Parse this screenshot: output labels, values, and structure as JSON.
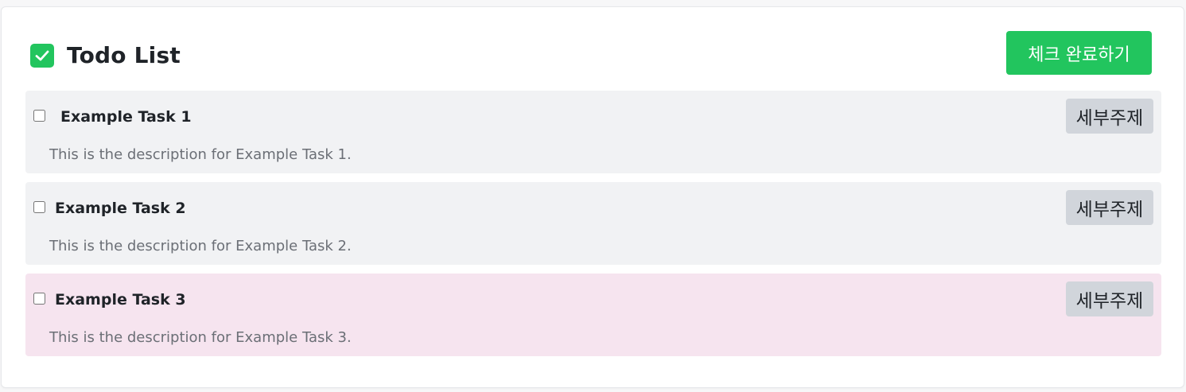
{
  "header": {
    "title": "Todo List",
    "done_button_label": "체크 완료하기",
    "icon": "checkbox-checked-icon"
  },
  "colors": {
    "accent": "#22c55e",
    "row_default": "#f1f2f4",
    "row_highlight": "#f6e4ef",
    "sub_button": "#d1d5db"
  },
  "tasks": [
    {
      "title": "Example Task 1",
      "description": "This is the description for Example Task 1.",
      "button_label": "세부주제",
      "checked": false,
      "highlight": false
    },
    {
      "title": "Example Task 2",
      "description": "This is the description for Example Task 2.",
      "button_label": "세부주제",
      "checked": false,
      "highlight": false
    },
    {
      "title": "Example Task 3",
      "description": "This is the description for Example Task 3.",
      "button_label": "세부주제",
      "checked": false,
      "highlight": true
    }
  ]
}
